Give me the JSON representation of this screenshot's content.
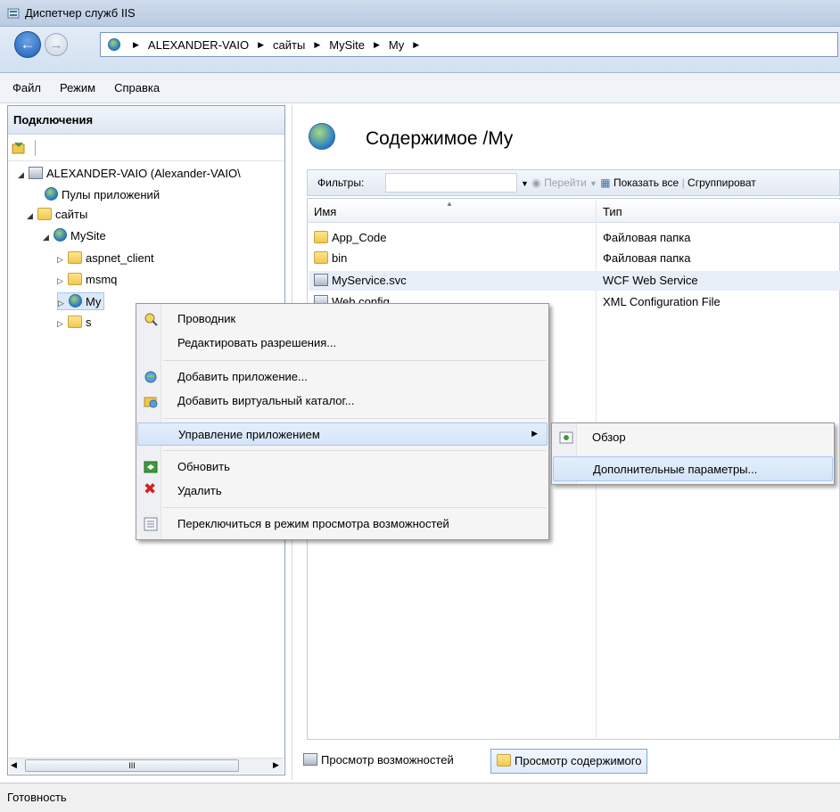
{
  "window": {
    "title": "Диспетчер служб IIS"
  },
  "address": {
    "segments": [
      "ALEXANDER-VAIO",
      "сайты",
      "MySite",
      "My"
    ]
  },
  "menu": {
    "items": [
      "Файл",
      "Режим",
      "Справка"
    ]
  },
  "connections": {
    "title": "Подключения",
    "tree": [
      {
        "label": "ALEXANDER-VAIO (Alexander-VAIO\\",
        "level": 0,
        "icon": "server-icon"
      },
      {
        "label": "Пулы приложений",
        "level": 1,
        "icon": "app-pool-icon"
      },
      {
        "label": "сайты",
        "level": 1,
        "icon": "sites-folder-icon"
      },
      {
        "label": "MySite",
        "level": 2,
        "icon": "globe-icon"
      },
      {
        "label": "aspnet_client",
        "level": 3,
        "icon": "folder-icon"
      },
      {
        "label": "msmq",
        "level": 3,
        "icon": "folder-icon"
      },
      {
        "label": "My",
        "level": 3,
        "icon": "app-icon"
      },
      {
        "label": "s",
        "level": 3,
        "icon": "folder-icon"
      }
    ],
    "scroll_glyph": "III"
  },
  "content": {
    "title": "Содержимое /My",
    "filter_label": "Фильтры:",
    "go_label": "Перейти",
    "show_all_label": "Показать все",
    "group_label": "Сгруппироват",
    "columns": {
      "name": "Имя",
      "type": "Тип"
    },
    "rows": [
      {
        "name": "App_Code",
        "type": "Файловая папка"
      },
      {
        "name": "bin",
        "type": "Файловая папка"
      },
      {
        "name": "MyService.svc",
        "type": "WCF Web Service"
      },
      {
        "name": "Web.config",
        "type": "XML Configuration File"
      }
    ]
  },
  "bottom_tabs": {
    "features": "Просмотр возможностей",
    "content": "Просмотр содержимого"
  },
  "context_menu": {
    "explore": "Проводник",
    "edit_permissions": "Редактировать разрешения...",
    "add_app": "Добавить приложение...",
    "add_vdir": "Добавить виртуальный каталог...",
    "manage_app": "Управление приложением",
    "refresh": "Обновить",
    "remove": "Удалить",
    "switch_features": "Переключиться в режим просмотра возможностей"
  },
  "submenu": {
    "browse": "Обзор",
    "advanced": "Дополнительные параметры..."
  },
  "status": {
    "text": "Готовность"
  }
}
